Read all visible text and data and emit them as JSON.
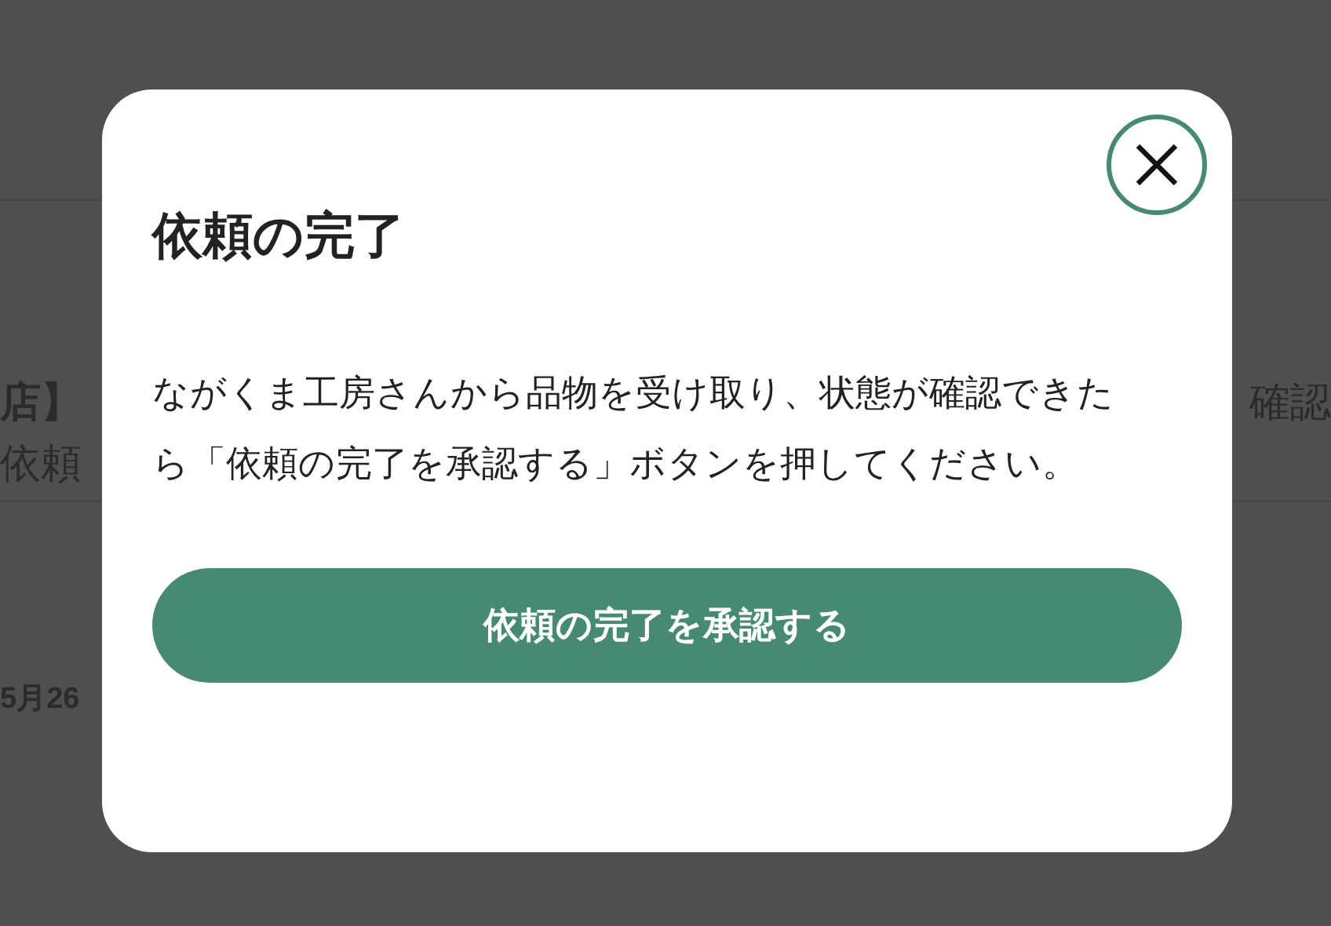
{
  "background": {
    "title_fragment": "店】",
    "subtitle_fragment": "依頼",
    "right_fragment": "確認",
    "date_fragment": "5月26"
  },
  "dialog": {
    "title": "依頼の完了",
    "message": "ながくま工房さんから品物を受け取り、状態が確認できたら「依頼の完了を承認する」ボタンを押してください。",
    "confirm_button": "依頼の完了を承認する"
  }
}
